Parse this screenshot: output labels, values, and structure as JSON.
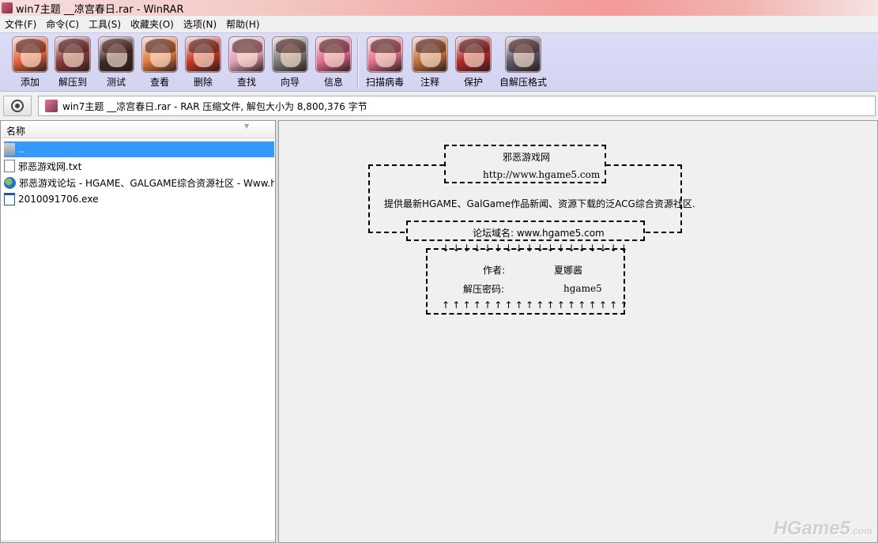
{
  "window": {
    "title": "win7主题 __凉宫春日.rar - WinRAR"
  },
  "menu": [
    "文件(F)",
    "命令(C)",
    "工具(S)",
    "收藏夹(O)",
    "选项(N)",
    "帮助(H)"
  ],
  "toolbar": {
    "buttons": [
      {
        "label": "添加",
        "icon": "add-icon",
        "color": "#e0613a"
      },
      {
        "label": "解压到",
        "icon": "extract-to-icon",
        "color": "#8a3a3a"
      },
      {
        "label": "测试",
        "icon": "test-icon",
        "color": "#3a2a2a"
      },
      {
        "label": "查看",
        "icon": "view-icon",
        "color": "#e07a3a"
      },
      {
        "label": "删除",
        "icon": "delete-icon",
        "color": "#c23a2a"
      },
      {
        "label": "查找",
        "icon": "find-icon",
        "color": "#e0a0b8"
      },
      {
        "label": "向导",
        "icon": "wizard-icon",
        "color": "#7a7a7a"
      },
      {
        "label": "信息",
        "icon": "info-icon",
        "color": "#e06a90"
      },
      {
        "label": "扫描病毒",
        "icon": "scan-virus-icon",
        "color": "#e07090"
      },
      {
        "label": "注释",
        "icon": "comment-icon",
        "color": "#c0703a"
      },
      {
        "label": "保护",
        "icon": "protect-icon",
        "color": "#b02a2a"
      },
      {
        "label": "自解压格式",
        "icon": "sfx-icon",
        "color": "#5a5a6a"
      }
    ]
  },
  "address": {
    "text": "win7主题 __凉宫春日.rar - RAR 压缩文件, 解包大小为 8,800,376 字节"
  },
  "filelist": {
    "column": "名称",
    "rows": [
      {
        "name": "..",
        "icon": "parent-folder-icon",
        "selected": true
      },
      {
        "name": "邪恶游戏网.txt",
        "icon": "text-file-icon",
        "selected": false
      },
      {
        "name": "邪恶游戏论坛 - HGAME、GALGAME综合资源社区 - Www.h",
        "icon": "web-shortcut-icon",
        "selected": false
      },
      {
        "name": "2010091706.exe",
        "icon": "exe-file-icon",
        "selected": false
      }
    ]
  },
  "comment": {
    "site_name": "邪恶游戏网",
    "site_url": "http://www.hgame5.com",
    "description": "提供最新HGAME、GalGame作品新闻、资源下载的泛ACG综合资源社区.",
    "forum": "论坛域名: www.hgame5.com",
    "arrows_down": "↓↓↓↓↓↓↓↓↓↓↓↓↓↓↓↓↓↓",
    "author_label": "作者:",
    "author_value": "夏娜酱",
    "password_label": "解压密码:",
    "password_value": "hgame5",
    "arrows_up": "↑↑↑↑↑↑↑↑↑↑↑↑↑↑↑↑↑↑"
  },
  "watermark": {
    "main": "HGame5",
    "suffix": ".com"
  }
}
